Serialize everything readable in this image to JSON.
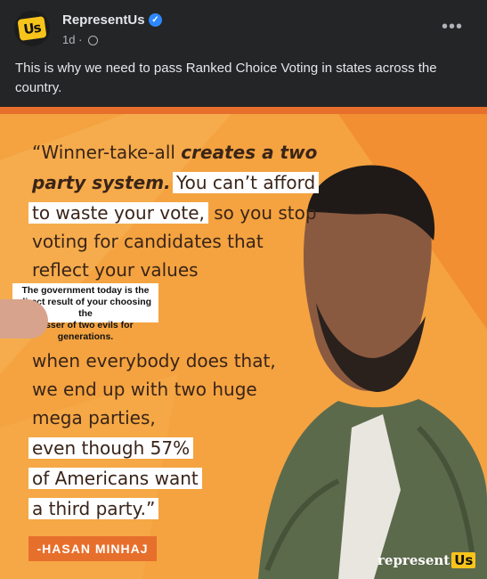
{
  "post": {
    "page_name": "RepresentUs",
    "avatar_text": "Us",
    "verified_glyph": "✓",
    "timestamp": "1d",
    "separator": "·",
    "more_glyph": "•••",
    "caption": "This is why we need to pass Ranked Choice Voting in states across the country."
  },
  "graphic": {
    "quote_lines": [
      {
        "pre": "“Winner-take-all ",
        "em": "creates a two",
        "post": ""
      },
      {
        "em": "party system.",
        "hl": "You can’t afford"
      },
      {
        "hl": "to waste your vote,",
        "post": " so you stop"
      },
      {
        "text": "voting for candidates that"
      },
      {
        "text": "reflect your values"
      },
      {
        "text": "when everybody does that,"
      },
      {
        "text": "we end up with two huge"
      },
      {
        "text": "mega parties,"
      },
      {
        "hl": "even though 57%"
      },
      {
        "hl": "of Americans want"
      },
      {
        "hl": "a third party.”"
      }
    ],
    "sticker": {
      "line1": "The government today is the",
      "line2": "direct result of your choosing the",
      "line3": "lesser of two evils for generations."
    },
    "attribution": "-HASAN MINHAJ",
    "brand_text": "represent",
    "brand_us": "Us",
    "colors": {
      "background": "#f4a340",
      "quote_text": "#3a2418",
      "attribution_bg": "#e76f2c",
      "top_stripe": "#e76f2c"
    }
  }
}
